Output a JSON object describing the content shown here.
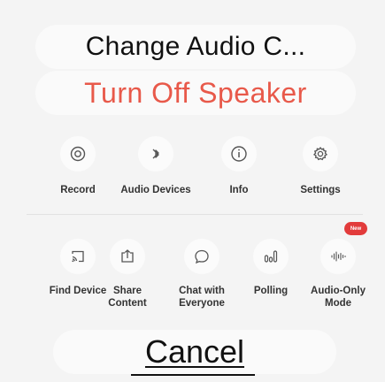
{
  "dialog": {
    "title": "Change Audio C...",
    "speaker_action": "Turn Off Speaker",
    "cancel_label": "Cancel"
  },
  "colors": {
    "accent_red": "#e8594a",
    "badge_red": "#e23b3b"
  },
  "row1": [
    {
      "label": "Record",
      "icon": "record-icon"
    },
    {
      "label": "Audio Devices",
      "icon": "bluetooth-icon"
    },
    {
      "label": "Info",
      "icon": "info-icon"
    },
    {
      "label": "Settings",
      "icon": "gear-icon"
    }
  ],
  "row2": [
    {
      "label_line1": "Find Device",
      "label_line2": "",
      "icon": "cast-icon"
    },
    {
      "label_line1": "Share",
      "label_line2": "Content",
      "icon": "share-icon"
    },
    {
      "label_line1": "Chat with",
      "label_line2": "Everyone",
      "icon": "chat-icon"
    },
    {
      "label_line1": "Polling",
      "label_line2": "",
      "icon": "polling-icon"
    },
    {
      "label_line1": "Audio-Only",
      "label_line2": "Mode",
      "icon": "audio-wave-icon"
    }
  ],
  "badge": {
    "text": "New"
  }
}
